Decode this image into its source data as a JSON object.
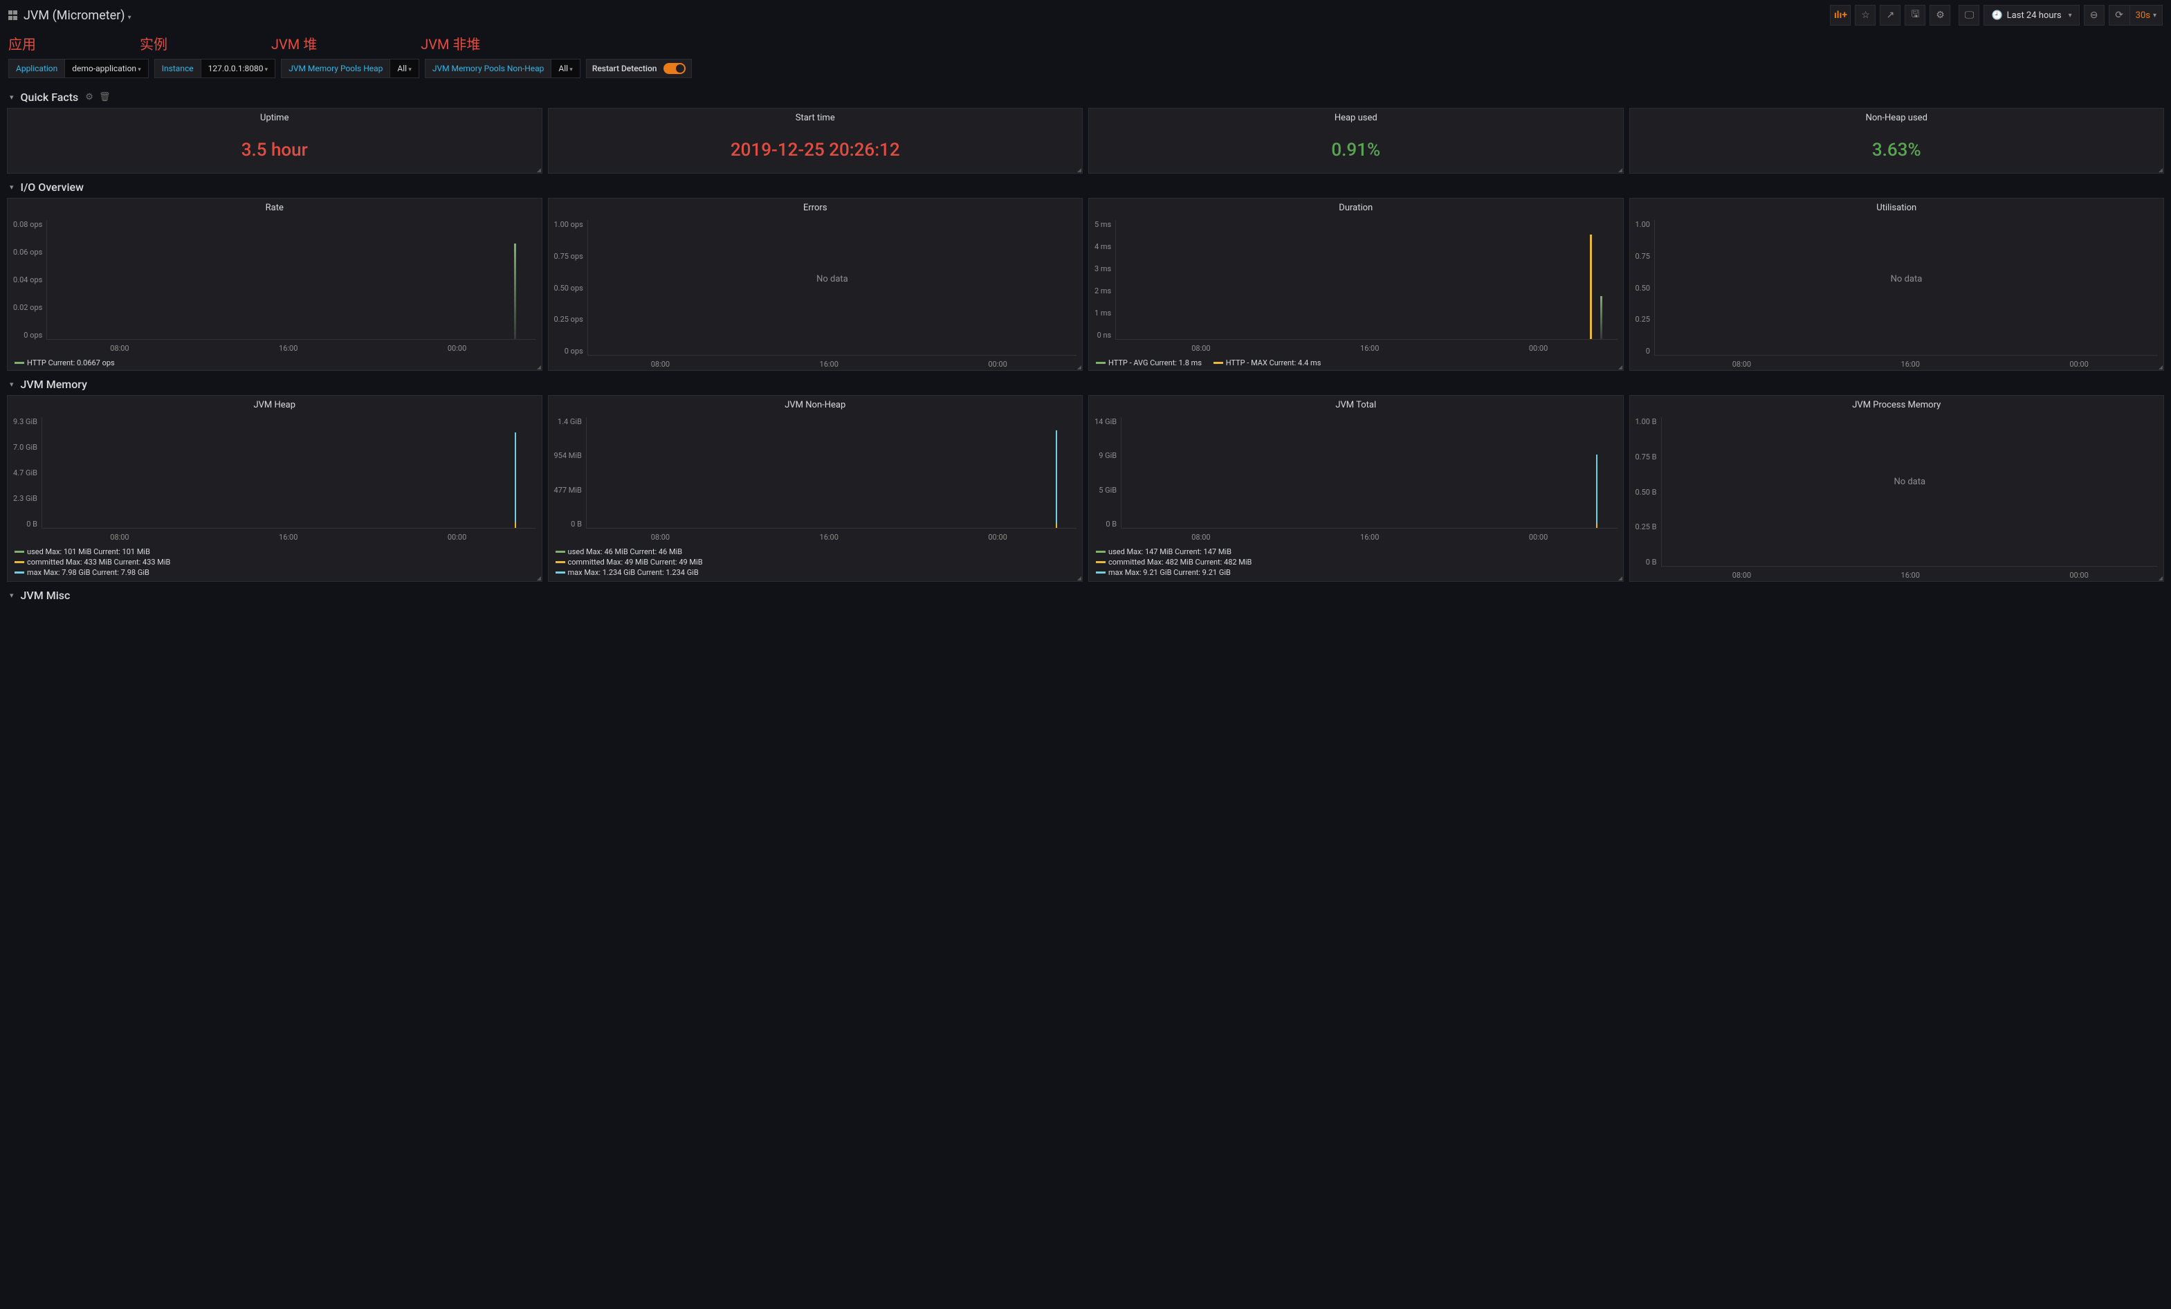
{
  "dashboard_title": "JVM (Micrometer)",
  "time_range": "Last 24 hours",
  "refresh_interval": "30s",
  "annotations": {
    "app": "应用",
    "instance": "实例",
    "heap": "JVM 堆",
    "nonheap": "JVM 非堆"
  },
  "vars": {
    "application": {
      "label": "Application",
      "value": "demo-application"
    },
    "instance": {
      "label": "Instance",
      "value": "127.0.0.1:8080"
    },
    "heap": {
      "label": "JVM Memory Pools Heap",
      "value": "All"
    },
    "nonheap": {
      "label": "JVM Memory Pools Non-Heap",
      "value": "All"
    },
    "restart": {
      "label": "Restart Detection"
    }
  },
  "rows": {
    "quick_facts": "Quick Facts",
    "io_overview": "I/O Overview",
    "jvm_memory": "JVM Memory",
    "jvm_misc": "JVM Misc"
  },
  "quick_facts": {
    "uptime": {
      "title": "Uptime",
      "value": "3.5 hour"
    },
    "start_time": {
      "title": "Start time",
      "value": "2019-12-25 20:26:12"
    },
    "heap_used": {
      "title": "Heap used",
      "value": "0.91%"
    },
    "nonheap_used": {
      "title": "Non-Heap used",
      "value": "3.63%"
    }
  },
  "io": {
    "rate": {
      "title": "Rate",
      "y_ticks": [
        "0.08 ops",
        "0.06 ops",
        "0.04 ops",
        "0.02 ops",
        "0 ops"
      ],
      "x_ticks": [
        "08:00",
        "16:00",
        "00:00"
      ],
      "legend": "HTTP  Current: 0.0667 ops"
    },
    "errors": {
      "title": "Errors",
      "y_ticks": [
        "1.00 ops",
        "0.75 ops",
        "0.50 ops",
        "0.25 ops",
        "0 ops"
      ],
      "x_ticks": [
        "08:00",
        "16:00",
        "00:00"
      ],
      "no_data": "No data"
    },
    "duration": {
      "title": "Duration",
      "y_ticks": [
        "5 ms",
        "4 ms",
        "3 ms",
        "2 ms",
        "1 ms",
        "0 ns"
      ],
      "x_ticks": [
        "08:00",
        "16:00",
        "00:00"
      ],
      "legend_avg": "HTTP - AVG  Current: 1.8 ms",
      "legend_max": "HTTP - MAX  Current: 4.4 ms"
    },
    "utilisation": {
      "title": "Utilisation",
      "y_ticks": [
        "1.00",
        "0.75",
        "0.50",
        "0.25",
        "0"
      ],
      "x_ticks": [
        "08:00",
        "16:00",
        "00:00"
      ],
      "no_data": "No data"
    }
  },
  "memory": {
    "heap": {
      "title": "JVM Heap",
      "y_ticks": [
        "9.3 GiB",
        "7.0 GiB",
        "4.7 GiB",
        "2.3 GiB",
        "0 B"
      ],
      "x_ticks": [
        "08:00",
        "16:00",
        "00:00"
      ],
      "legend": {
        "used": "used  Max: 101 MiB  Current: 101 MiB",
        "committed": "committed  Max: 433 MiB  Current: 433 MiB",
        "max": "max  Max: 7.98 GiB  Current: 7.98 GiB"
      }
    },
    "nonheap": {
      "title": "JVM Non-Heap",
      "y_ticks": [
        "1.4 GiB",
        "954 MiB",
        "477 MiB",
        "0 B"
      ],
      "x_ticks": [
        "08:00",
        "16:00",
        "00:00"
      ],
      "legend": {
        "used": "used  Max: 46 MiB  Current: 46 MiB",
        "committed": "committed  Max: 49 MiB  Current: 49 MiB",
        "max": "max  Max: 1.234 GiB  Current: 1.234 GiB"
      }
    },
    "total": {
      "title": "JVM Total",
      "y_ticks": [
        "14 GiB",
        "9 GiB",
        "5 GiB",
        "0 B"
      ],
      "x_ticks": [
        "08:00",
        "16:00",
        "00:00"
      ],
      "legend": {
        "used": "used  Max: 147 MiB  Current: 147 MiB",
        "committed": "committed  Max: 482 MiB  Current: 482 MiB",
        "max": "max  Max: 9.21 GiB  Current: 9.21 GiB"
      }
    },
    "process": {
      "title": "JVM Process Memory",
      "y_ticks": [
        "1.00 B",
        "0.75 B",
        "0.50 B",
        "0.25 B",
        "0 B"
      ],
      "x_ticks": [
        "08:00",
        "16:00",
        "00:00"
      ],
      "no_data": "No data"
    }
  },
  "chart_data": [
    {
      "panel": "Rate",
      "type": "line",
      "x_range": [
        "08:00",
        "00:00"
      ],
      "ylim": [
        0,
        0.08
      ],
      "ylabel": "ops",
      "series": [
        {
          "name": "HTTP",
          "current": 0.0667,
          "values_note": "brief spike near end ~0.067 ops"
        }
      ]
    },
    {
      "panel": "Errors",
      "type": "line",
      "x_range": [
        "08:00",
        "00:00"
      ],
      "ylim": [
        0,
        1.0
      ],
      "ylabel": "ops",
      "series": [],
      "no_data": true
    },
    {
      "panel": "Duration",
      "type": "line",
      "x_range": [
        "08:00",
        "00:00"
      ],
      "ylim": [
        0,
        5
      ],
      "ylabel": "ms",
      "series": [
        {
          "name": "HTTP - AVG",
          "current": 1.8,
          "approx_recent": [
            1.8
          ]
        },
        {
          "name": "HTTP - MAX",
          "current": 4.4,
          "approx_recent": [
            4.4
          ]
        }
      ]
    },
    {
      "panel": "Utilisation",
      "type": "line",
      "x_range": [
        "08:00",
        "00:00"
      ],
      "ylim": [
        0,
        1.0
      ],
      "series": [],
      "no_data": true
    },
    {
      "panel": "JVM Heap",
      "type": "line",
      "x_range": [
        "08:00",
        "00:00"
      ],
      "ylim": [
        0,
        9.3
      ],
      "yunit": "GiB",
      "series": [
        {
          "name": "used",
          "max": "101 MiB",
          "current": "101 MiB"
        },
        {
          "name": "committed",
          "max": "433 MiB",
          "current": "433 MiB"
        },
        {
          "name": "max",
          "max": "7.98 GiB",
          "current": "7.98 GiB"
        }
      ]
    },
    {
      "panel": "JVM Non-Heap",
      "type": "line",
      "x_range": [
        "08:00",
        "00:00"
      ],
      "ylim": [
        0,
        1.4
      ],
      "yunit": "GiB",
      "series": [
        {
          "name": "used",
          "max": "46 MiB",
          "current": "46 MiB"
        },
        {
          "name": "committed",
          "max": "49 MiB",
          "current": "49 MiB"
        },
        {
          "name": "max",
          "max": "1.234 GiB",
          "current": "1.234 GiB"
        }
      ]
    },
    {
      "panel": "JVM Total",
      "type": "line",
      "x_range": [
        "08:00",
        "00:00"
      ],
      "ylim": [
        0,
        14
      ],
      "yunit": "GiB",
      "series": [
        {
          "name": "used",
          "max": "147 MiB",
          "current": "147 MiB"
        },
        {
          "name": "committed",
          "max": "482 MiB",
          "current": "482 MiB"
        },
        {
          "name": "max",
          "max": "9.21 GiB",
          "current": "9.21 GiB"
        }
      ]
    },
    {
      "panel": "JVM Process Memory",
      "type": "line",
      "x_range": [
        "08:00",
        "00:00"
      ],
      "ylim": [
        0,
        1.0
      ],
      "yunit": "B",
      "series": [],
      "no_data": true
    }
  ]
}
